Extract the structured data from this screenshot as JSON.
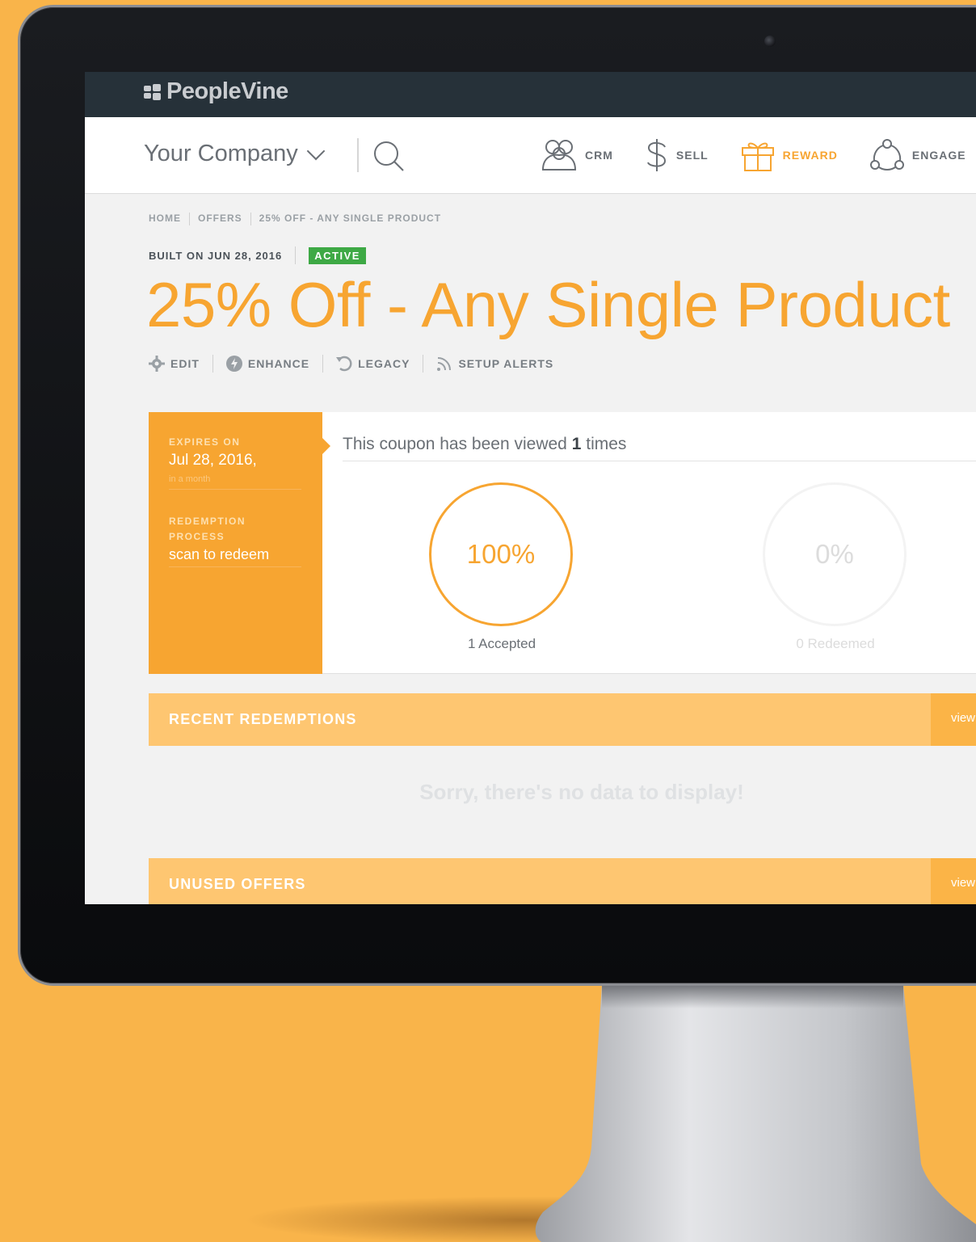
{
  "app": {
    "logo_text": "PeopleVine"
  },
  "navbar": {
    "company": "Your Company",
    "items": [
      {
        "label": "CRM",
        "icon": "people-icon",
        "active": false
      },
      {
        "label": "SELL",
        "icon": "dollar-icon",
        "active": false
      },
      {
        "label": "REWARD",
        "icon": "gift-icon",
        "active": true
      },
      {
        "label": "ENGAGE",
        "icon": "network-icon",
        "active": false
      }
    ]
  },
  "breadcrumb": [
    "HOME",
    "OFFERS",
    "25% OFF - ANY SINGLE PRODUCT"
  ],
  "offer": {
    "built_on": "BUILT ON JUN 28, 2016",
    "status": "ACTIVE",
    "title": "25% Off - Any Single Product"
  },
  "actions": [
    "EDIT",
    "ENHANCE",
    "LEGACY",
    "SETUP ALERTS"
  ],
  "sidebar": {
    "expires_label": "EXPIRES ON",
    "expires_value": "Jul 28, 2016,",
    "expires_relative": "in a month",
    "redemption_label": "REDEMPTION PROCESS",
    "redemption_value": "scan to redeem"
  },
  "stats": {
    "viewed_prefix": "This coupon has been viewed",
    "viewed_count": "1",
    "viewed_suffix": "times",
    "accepted_percent": "100%",
    "accepted_caption": "1 Accepted",
    "redeemed_percent": "0%",
    "redeemed_caption": "0 Redeemed"
  },
  "sections": {
    "recent_title": "RECENT REDEMPTIONS",
    "recent_link": "view",
    "empty_message": "Sorry, there's no data to display!",
    "unused_title": "UNUSED OFFERS",
    "unused_link": "view"
  },
  "colors": {
    "accent": "#f7a531",
    "topbar": "#263139",
    "active_badge": "#3ea945",
    "section_bar": "#fec671"
  }
}
